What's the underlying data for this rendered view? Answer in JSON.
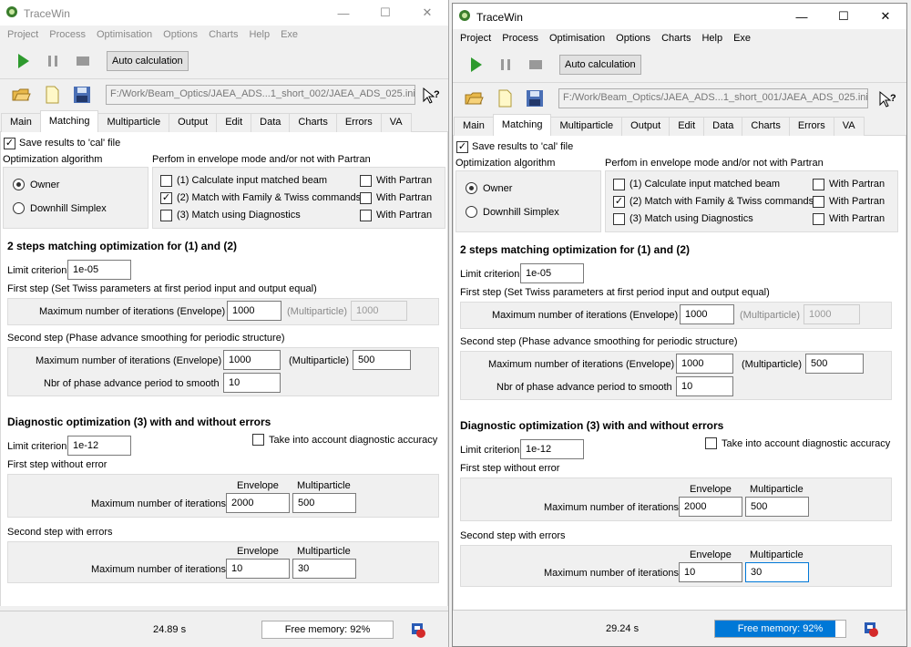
{
  "app": {
    "title": "TraceWin"
  },
  "menu": [
    "Project",
    "Process",
    "Optimisation",
    "Options",
    "Charts",
    "Help",
    "Exe"
  ],
  "toolbar": {
    "auto_calc": "Auto calculation"
  },
  "tabs": [
    "Main",
    "Matching",
    "Multiparticle",
    "Output",
    "Edit",
    "Data",
    "Charts",
    "Errors",
    "VA"
  ],
  "colors": {
    "accent": "#0078d7",
    "disabled_text": "#888888"
  },
  "labels": {
    "save_results": "Save results to 'cal' file",
    "opt_algo": "Optimization algorithm",
    "envelope_mode": "Perfom in envelope mode and/or not with Partran",
    "owner": "Owner",
    "downhill": "Downhill Simplex",
    "opt1": "(1) Calculate input matched beam",
    "opt2": "(2) Match with Family & Twiss commands",
    "opt3": "(3) Match using Diagnostics",
    "with_partran": "With Partran",
    "two_steps": "2 steps matching optimization for (1) and (2)",
    "limit": "Limit criterion",
    "first_step": "First step (Set Twiss parameters at first period input and output equal)",
    "max_iter_env": "Maximum number of iterations (Envelope)",
    "multiparticle_paren": "(Multiparticle)",
    "second_step": "Second step (Phase advance smoothing for periodic structure)",
    "nbr_phase": "Nbr of phase advance period to smooth",
    "diag_opt": "Diagnostic optimization (3) with and without errors",
    "take_diag": "Take into account diagnostic accuracy",
    "first_no_err": "First step without error",
    "second_err": "Second step with errors",
    "envelope": "Envelope",
    "multiparticle": "Multiparticle",
    "max_iter": "Maximum number of iterations"
  },
  "windows": [
    {
      "path": "F:/Work/Beam_Optics/JAEA_ADS...1_short_002/JAEA_ADS_025.ini",
      "values": {
        "limit1": "1e-05",
        "iter_env1": "1000",
        "iter_mp1": "1000",
        "iter_env2": "1000",
        "iter_mp2": "500",
        "nbr_phase": "10",
        "limit_diag": "1e-12",
        "d1_env": "2000",
        "d1_mp": "500",
        "d2_env": "10",
        "d2_mp": "30"
      },
      "status": {
        "time": "24.89 s",
        "memory": "Free memory: 92%",
        "memory_fraction": 0
      }
    },
    {
      "path": "F:/Work/Beam_Optics/JAEA_ADS...1_short_001/JAEA_ADS_025.ini",
      "values": {
        "limit1": "1e-05",
        "iter_env1": "1000",
        "iter_mp1": "1000",
        "iter_env2": "1000",
        "iter_mp2": "500",
        "nbr_phase": "10",
        "limit_diag": "1e-12",
        "d1_env": "2000",
        "d1_mp": "500",
        "d2_env": "10",
        "d2_mp": "30"
      },
      "status": {
        "time": "29.24 s",
        "memory": "Free memory: 92%",
        "memory_fraction": 0.92
      }
    }
  ]
}
